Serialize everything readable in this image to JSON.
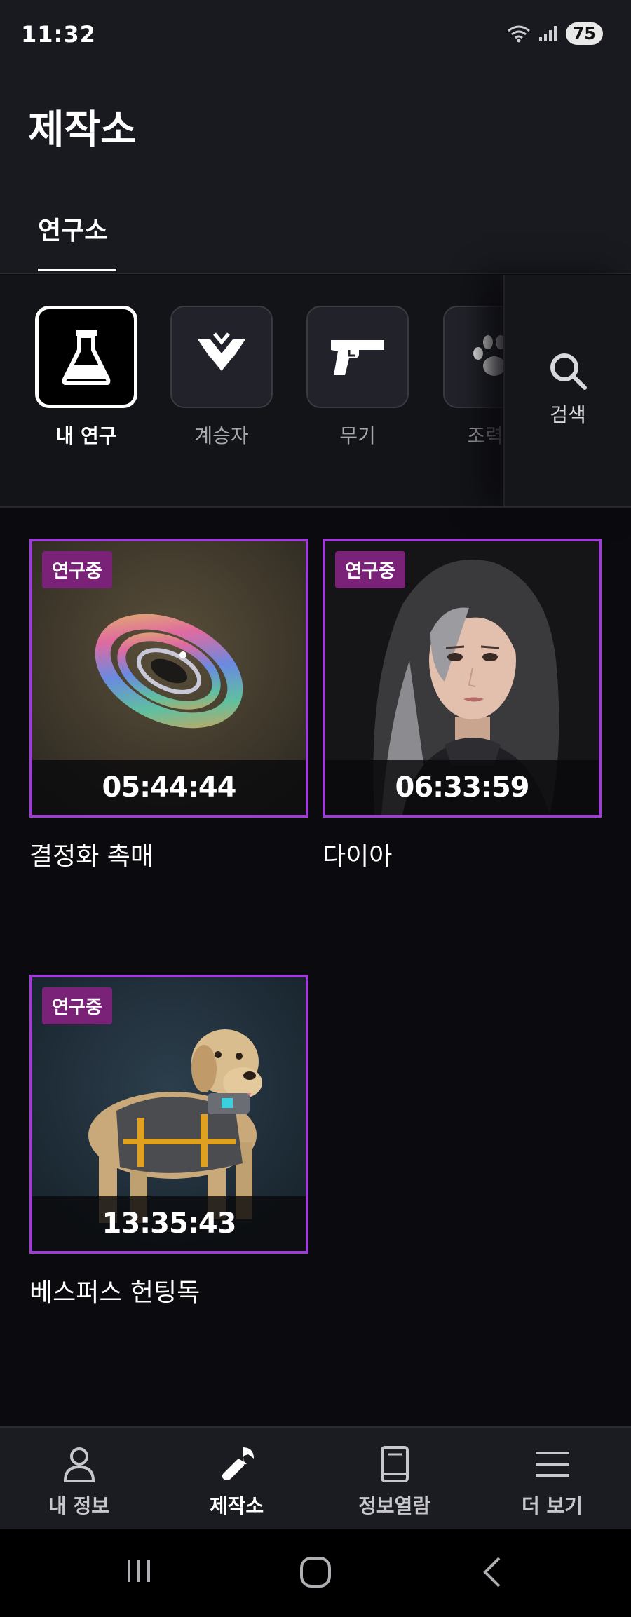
{
  "status_bar": {
    "time": "11:32",
    "battery": "75"
  },
  "header": {
    "title": "제작소",
    "tabs": [
      {
        "label": "연구소",
        "active": true
      }
    ]
  },
  "categories": {
    "items": [
      {
        "label": "내 연구",
        "icon": "flask-icon",
        "active": true
      },
      {
        "label": "계승자",
        "icon": "chevron-emblem-icon",
        "active": false
      },
      {
        "label": "무기",
        "icon": "pistol-icon",
        "active": false
      },
      {
        "label": "조력자",
        "icon": "paw-icon",
        "active": false
      }
    ],
    "search": {
      "label": "검색",
      "icon": "search-icon"
    }
  },
  "research": {
    "items": [
      {
        "badge": "연구중",
        "timer": "05:44:44",
        "name": "결정화 촉매",
        "image": "rainbow-ring-catalyst"
      },
      {
        "badge": "연구중",
        "timer": "06:33:59",
        "name": "다이아",
        "image": "character-portrait"
      },
      {
        "badge": "연구중",
        "timer": "13:35:43",
        "name": "베스퍼스 헌팅독",
        "image": "hunting-dog"
      }
    ]
  },
  "bottom_nav": {
    "items": [
      {
        "label": "내 정보",
        "icon": "person-icon",
        "active": false
      },
      {
        "label": "제작소",
        "icon": "wrench-icon",
        "active": true
      },
      {
        "label": "정보열람",
        "icon": "book-icon",
        "active": false
      },
      {
        "label": "더 보기",
        "icon": "menu-icon",
        "active": false
      }
    ]
  },
  "colors": {
    "accent_border": "#9b3fd1",
    "badge_bg": "#7a2178",
    "background": "#0b0b0f",
    "header_bg": "#191a1f"
  }
}
